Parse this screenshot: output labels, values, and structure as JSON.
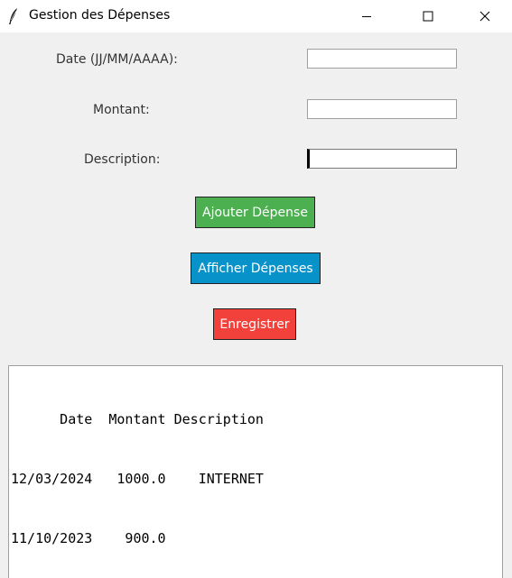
{
  "window": {
    "title": "Gestion des Dépenses"
  },
  "form": {
    "date_label": "Date (JJ/MM/AAAA):",
    "amount_label": "Montant:",
    "description_label": "Description:",
    "date_value": "",
    "amount_value": "",
    "description_value": ""
  },
  "buttons": {
    "add_label": "Ajouter Dépense",
    "show_label": "Afficher Dépenses",
    "save_label": "Enregistrer"
  },
  "colors": {
    "add": "#4caf50",
    "show": "#0792c9",
    "save": "#f2403a"
  },
  "output": {
    "lines": [
      "      Date  Montant Description",
      "12/03/2024   1000.0    INTERNET",
      "11/10/2023    900.0"
    ]
  },
  "icons": {
    "app": "feather-icon",
    "minimize": "minimize-icon",
    "maximize": "maximize-icon",
    "close": "close-icon"
  }
}
